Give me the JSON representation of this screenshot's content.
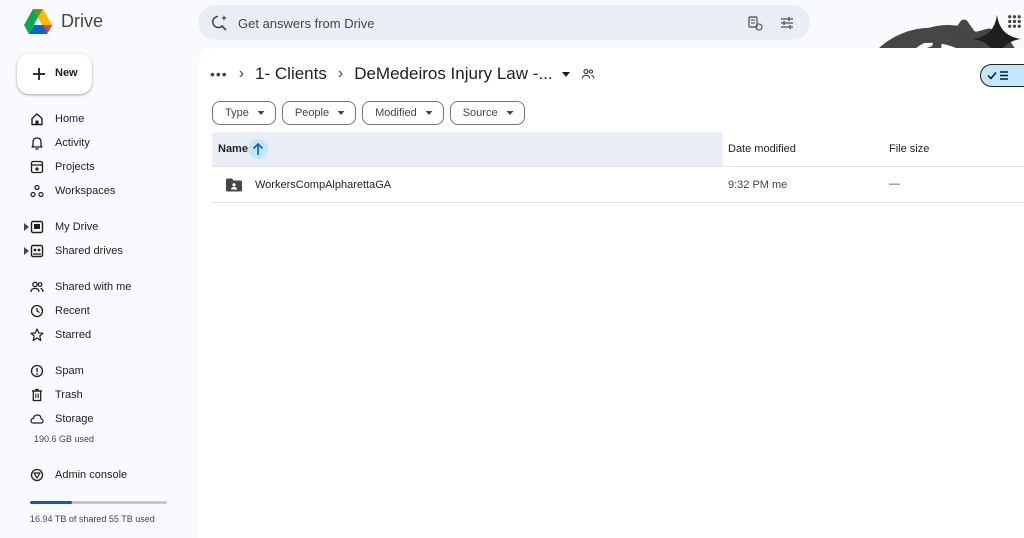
{
  "app": {
    "name": "Drive"
  },
  "search": {
    "placeholder": "Get answers from Drive"
  },
  "sidebar": {
    "new_label": "New",
    "items": [
      {
        "label": "Home",
        "icon": "home-icon"
      },
      {
        "label": "Activity",
        "icon": "bell-icon"
      },
      {
        "label": "Projects",
        "icon": "projects-icon"
      },
      {
        "label": "Workspaces",
        "icon": "workspaces-icon"
      },
      {
        "label": "My Drive",
        "icon": "my-drive-icon"
      },
      {
        "label": "Shared drives",
        "icon": "shared-drives-icon"
      },
      {
        "label": "Shared with me",
        "icon": "people-icon"
      },
      {
        "label": "Recent",
        "icon": "clock-icon"
      },
      {
        "label": "Starred",
        "icon": "star-icon"
      },
      {
        "label": "Spam",
        "icon": "spam-icon"
      },
      {
        "label": "Trash",
        "icon": "trash-icon"
      },
      {
        "label": "Storage",
        "icon": "cloud-icon"
      },
      {
        "label": "Admin console",
        "icon": "admin-icon"
      }
    ],
    "storage_used": "190.6 GB used",
    "shared_storage": "16.94 TB of shared 55 TB used",
    "shared_storage_fraction": 0.31
  },
  "breadcrumb": {
    "more": "•••",
    "separator": "›",
    "items": [
      "1- Clients",
      "DeMedeiros Injury Law -..."
    ]
  },
  "filters": [
    "Type",
    "People",
    "Modified",
    "Source"
  ],
  "table": {
    "columns": {
      "name": "Name",
      "date": "Date modified",
      "size": "File size"
    },
    "rows": [
      {
        "name": "WorkersCompAlpharettaGA",
        "date": "9:32 PM me",
        "size": "—",
        "icon": "shared-folder-icon"
      }
    ]
  },
  "colors": {
    "accent": "#0b57d0",
    "selected": "#c2e7ff",
    "background": "#f8fafd",
    "search": "#e9eef6"
  }
}
